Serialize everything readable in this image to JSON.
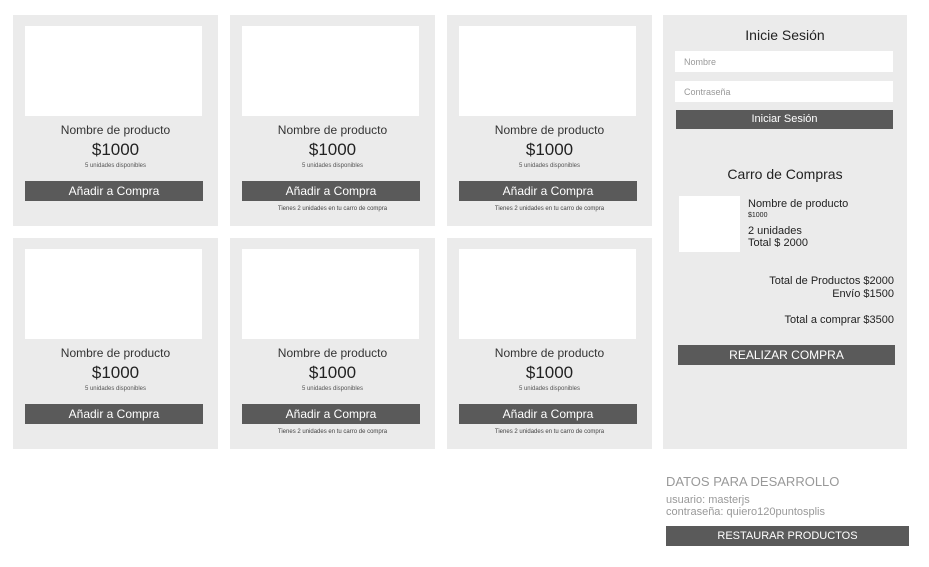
{
  "products": [
    {
      "name": "Nombre de producto",
      "price": "$1000",
      "stock": "5 unidades disponibles",
      "button": "Añadir a Compra",
      "in_cart": ""
    },
    {
      "name": "Nombre de producto",
      "price": "$1000",
      "stock": "5 unidades disponibles",
      "button": "Añadir a Compra",
      "in_cart": "Tienes 2 unidades en tu carro de compra"
    },
    {
      "name": "Nombre de producto",
      "price": "$1000",
      "stock": "5 unidades disponibles",
      "button": "Añadir a Compra",
      "in_cart": "Tienes 2 unidades en tu carro de compra"
    },
    {
      "name": "Nombre de producto",
      "price": "$1000",
      "stock": "5 unidades disponibles",
      "button": "Añadir a Compra",
      "in_cart": ""
    },
    {
      "name": "Nombre de producto",
      "price": "$1000",
      "stock": "5 unidades disponibles",
      "button": "Añadir a Compra",
      "in_cart": "Tienes 2 unidades en tu carro de compra"
    },
    {
      "name": "Nombre de producto",
      "price": "$1000",
      "stock": "5 unidades disponibles",
      "button": "Añadir a Compra",
      "in_cart": "Tienes 2 unidades en tu carro de compra"
    }
  ],
  "login": {
    "title": "Inicie Sesión",
    "name_placeholder": "Nombre",
    "password_placeholder": "Contraseña",
    "button": "Iniciar Sesión"
  },
  "cart": {
    "title": "Carro de Compras",
    "item": {
      "name": "Nombre de producto",
      "price": "$1000",
      "units": "2 unidades",
      "total": "Total $ 2000"
    },
    "products_total": "Total de Productos $2000",
    "shipping": "Envío $1500",
    "grand_total": "Total a comprar $3500",
    "checkout_button": "REALIZAR COMPRA"
  },
  "dev": {
    "title": "DATOS PARA DESARROLLO",
    "user": "usuario: masterjs",
    "password": "contraseña: quiero120puntosplis",
    "restore_button": "RESTAURAR PRODUCTOS"
  },
  "colors": {
    "panel_bg": "#ebebeb",
    "button_bg": "#5a5a5a",
    "button_text": "#ffffff"
  }
}
